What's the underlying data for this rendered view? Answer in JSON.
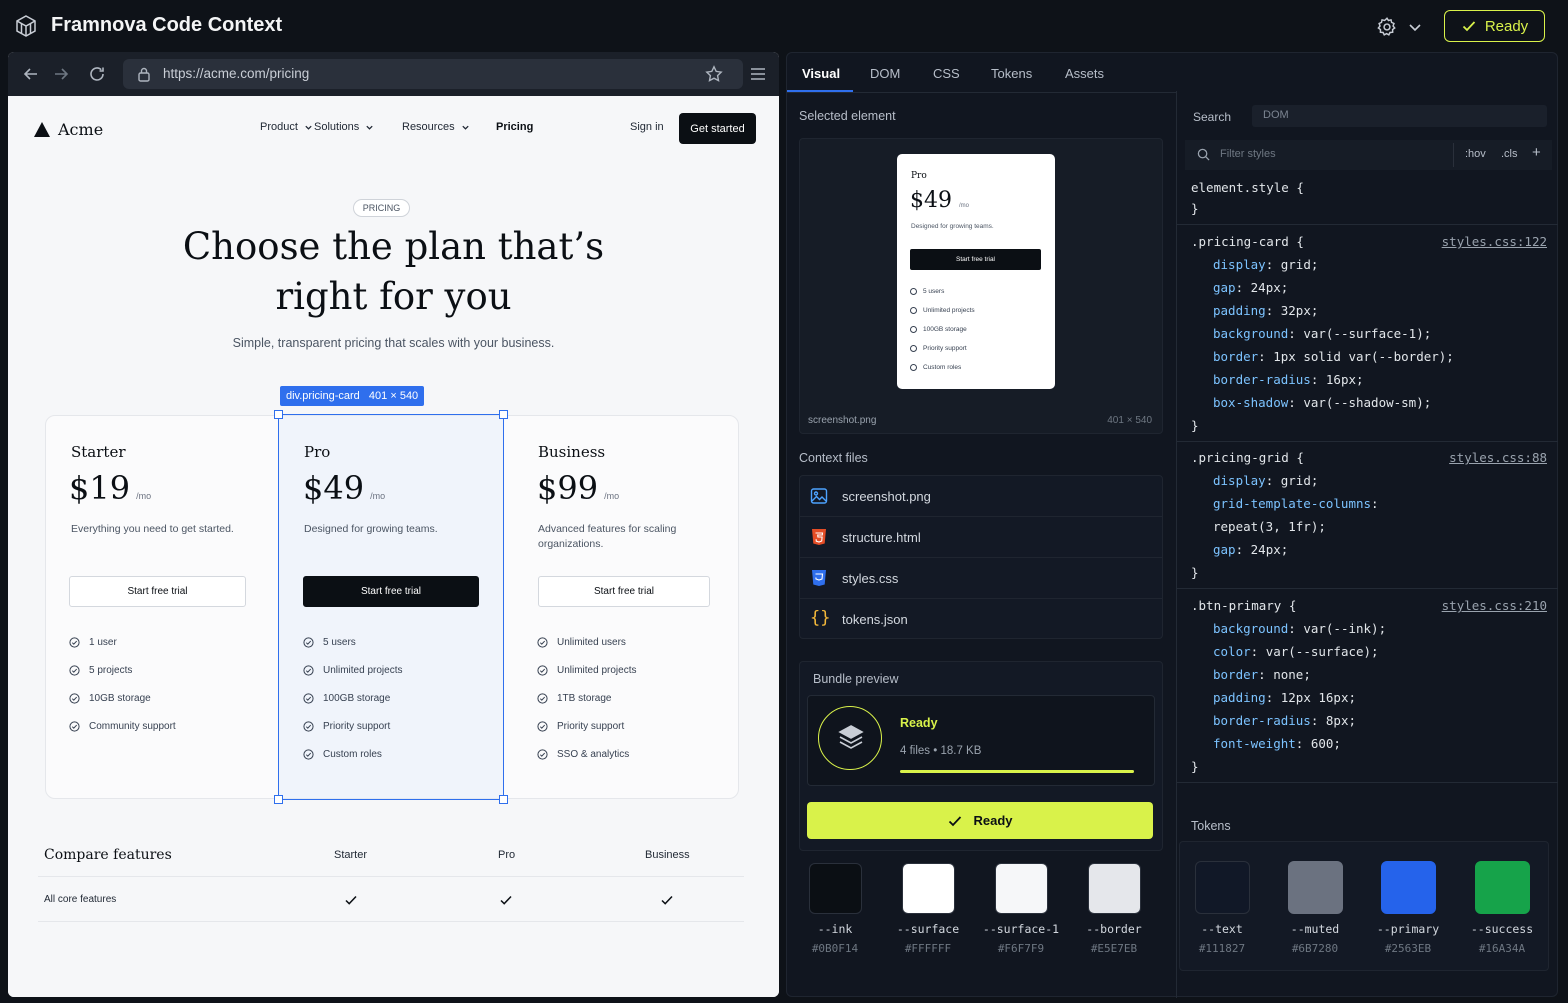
{
  "app": {
    "title": "Framnova Code Context",
    "ready_label": "Ready"
  },
  "browser": {
    "url": "https://acme.com/pricing"
  },
  "site": {
    "brand": "Acme",
    "nav": [
      "Product",
      "Solutions",
      "Resources",
      "Pricing"
    ],
    "signin": "Sign in",
    "cta": "Get started",
    "eyebrow": "PRICING",
    "hero_line1": "Choose the plan that’s",
    "hero_line2": "right for you",
    "subhero": "Simple, transparent pricing that scales with your business.",
    "selection_tag": "div.pricing-card   401 × 540",
    "plans": [
      {
        "name": "Starter",
        "price": "$19",
        "per": "/mo",
        "desc": "Everything you need to get started.",
        "cta": "Start free trial",
        "features": [
          "1 user",
          "5 projects",
          "10GB storage",
          "Community support"
        ]
      },
      {
        "name": "Pro",
        "price": "$49",
        "per": "/mo",
        "desc": "Designed for growing teams.",
        "cta": "Start free trial",
        "features": [
          "5 users",
          "Unlimited projects",
          "100GB storage",
          "Priority support",
          "Custom roles"
        ]
      },
      {
        "name": "Business",
        "price": "$99",
        "per": "/mo",
        "desc": "Advanced features for scaling organizations.",
        "cta": "Start free trial",
        "features": [
          "Unlimited users",
          "Unlimited projects",
          "1TB storage",
          "Priority support",
          "SSO & analytics"
        ]
      }
    ],
    "compare": {
      "title": "Compare features",
      "cols": [
        "Starter",
        "Pro",
        "Business"
      ],
      "row_label": "All core features"
    }
  },
  "inspector": {
    "tabs": [
      "Visual",
      "DOM",
      "CSS",
      "Tokens",
      "Assets"
    ],
    "selected_label": "Selected element",
    "preview": {
      "name": "Pro",
      "price": "$49",
      "per": "/mo",
      "desc": "Designed for growing teams.",
      "cta": "Start free trial",
      "features": [
        "5 users",
        "Unlimited projects",
        "100GB storage",
        "Priority support",
        "Custom roles"
      ],
      "file": "screenshot.png",
      "dims": "401 × 540"
    },
    "context_label": "Context files",
    "files": [
      "screenshot.png",
      "structure.html",
      "styles.css",
      "tokens.json"
    ],
    "bundle_label": "Bundle preview",
    "bundle_status": "Ready",
    "bundle_summary": "4 files • 18.7 KB",
    "bundle_progress": 1.0,
    "bundle_button": "Ready",
    "swatches": [
      {
        "name": "--ink",
        "hex": "#0B0F14"
      },
      {
        "name": "--surface",
        "hex": "#FFFFFF"
      },
      {
        "name": "--surface-1",
        "hex": "#F6F7F9"
      },
      {
        "name": "--border",
        "hex": "#E5E7EB"
      }
    ]
  },
  "styles": {
    "search_label": "Search",
    "search_value": "DOM",
    "filter_placeholder": "Filter styles",
    "hov": ":hov",
    "cls": ".cls",
    "plus": "+",
    "element_style": "element.style {",
    "close": "}",
    "rules": [
      {
        "selector": ".pricing-card {",
        "source": "styles.css:122",
        "decls": [
          [
            "display",
            "grid;"
          ],
          [
            "gap",
            "24px;"
          ],
          [
            "padding",
            "32px;"
          ],
          [
            "background",
            "var(--surface-1);"
          ],
          [
            "border",
            "1px solid var(--border);"
          ],
          [
            "border-radius",
            "16px;"
          ],
          [
            "box-shadow",
            "var(--shadow-sm);"
          ]
        ]
      },
      {
        "selector": ".pricing-grid {",
        "source": "styles.css:88",
        "decls": [
          [
            "display",
            "grid;"
          ],
          [
            "grid-template-columns",
            ""
          ],
          [
            "",
            "repeat(3, 1fr);"
          ],
          [
            "gap",
            "24px;"
          ]
        ]
      },
      {
        "selector": ".btn-primary {",
        "source": "styles.css:210",
        "decls": [
          [
            "background",
            "var(--ink);"
          ],
          [
            "color",
            "var(--surface);"
          ],
          [
            "border",
            "none;"
          ],
          [
            "padding",
            "12px 16px;"
          ],
          [
            "border-radius",
            "8px;"
          ],
          [
            "font-weight",
            "600;"
          ]
        ]
      }
    ],
    "tokens_label": "Tokens",
    "tokens": [
      {
        "name": "--text",
        "hex": "#111827"
      },
      {
        "name": "--muted",
        "hex": "#6B7280"
      },
      {
        "name": "--primary",
        "hex": "#2563EB"
      },
      {
        "name": "--success",
        "hex": "#16A34A"
      }
    ]
  }
}
